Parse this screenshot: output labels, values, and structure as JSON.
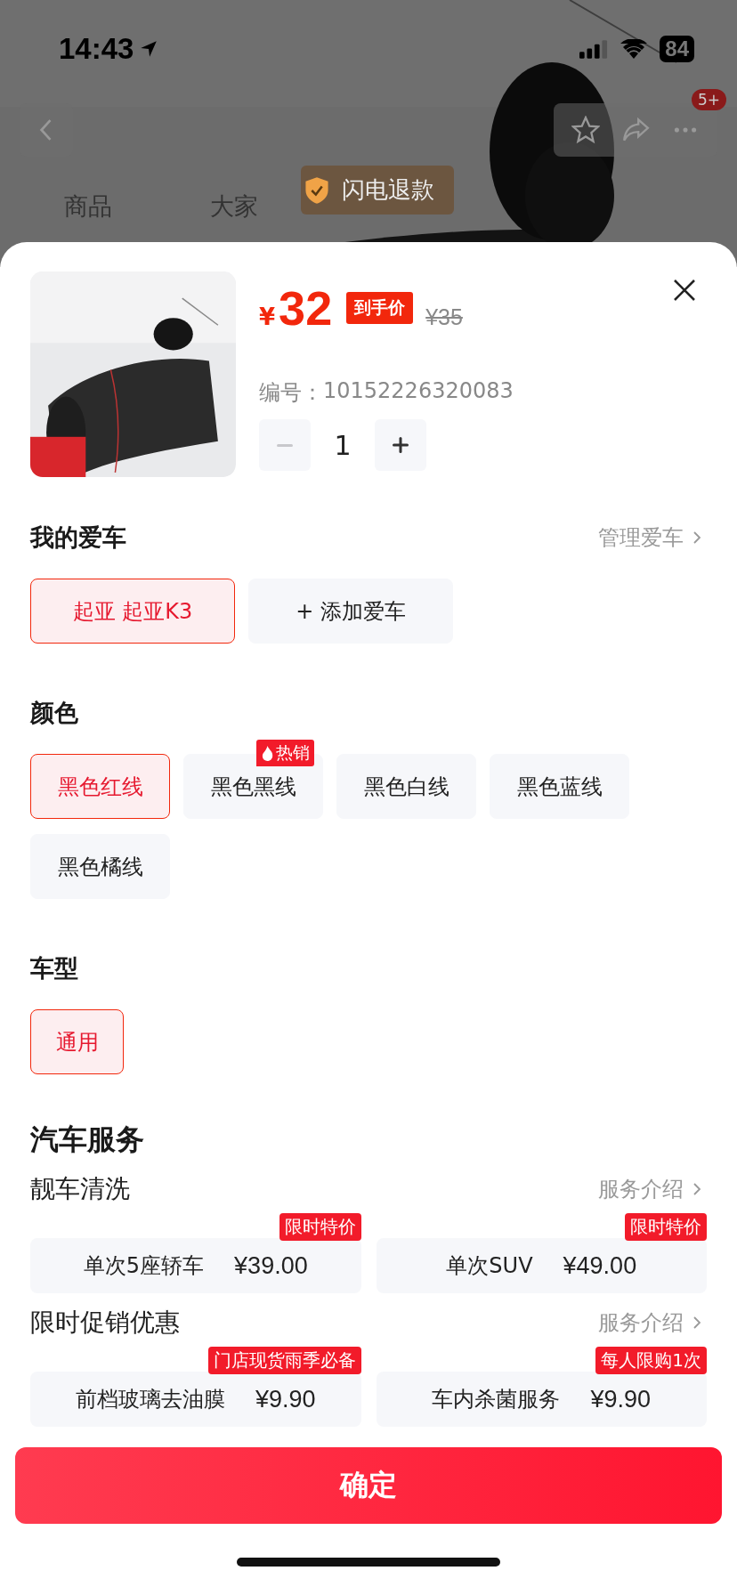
{
  "status_bar": {
    "time": "14:43",
    "battery": "84"
  },
  "nav": {
    "badge": "5+",
    "tabs": [
      {
        "label": "商品"
      },
      {
        "label": "大家"
      }
    ]
  },
  "toast": "闪电退款",
  "product": {
    "currency": "¥",
    "price": "32",
    "price_tag": "到手价",
    "original_price": "¥35",
    "sku_label": "编号：",
    "sku": "10152226320083",
    "quantity": "1"
  },
  "my_car": {
    "title": "我的爱车",
    "manage": "管理爱车",
    "options": [
      {
        "label": "起亚 起亚K3",
        "selected": true
      }
    ],
    "add": "+ 添加爱车"
  },
  "color": {
    "title": "颜色",
    "options": [
      {
        "label": "黑色红线",
        "selected": true
      },
      {
        "label": "黑色黑线",
        "selected": false,
        "badge": "热销"
      },
      {
        "label": "黑色白线",
        "selected": false
      },
      {
        "label": "黑色蓝线",
        "selected": false
      },
      {
        "label": "黑色橘线",
        "selected": false
      }
    ]
  },
  "model": {
    "title": "车型",
    "options": [
      {
        "label": "通用",
        "selected": true
      }
    ]
  },
  "services": {
    "title": "汽车服务",
    "groups": [
      {
        "title": "靓车清洗",
        "link": "服务介绍",
        "items": [
          {
            "name": "单次5座轿车",
            "price": "¥39.00",
            "tag": "限时特价"
          },
          {
            "name": "单次SUV",
            "price": "¥49.00",
            "tag": "限时特价"
          }
        ]
      },
      {
        "title": "限时促销优惠",
        "link": "服务介绍",
        "items": [
          {
            "name": "前档玻璃去油膜",
            "price": "¥9.90",
            "tag": "门店现货雨季必备"
          },
          {
            "name": "车内杀菌服务",
            "price": "¥9.90",
            "tag": "每人限购1次"
          }
        ]
      }
    ]
  },
  "confirm": "确定"
}
